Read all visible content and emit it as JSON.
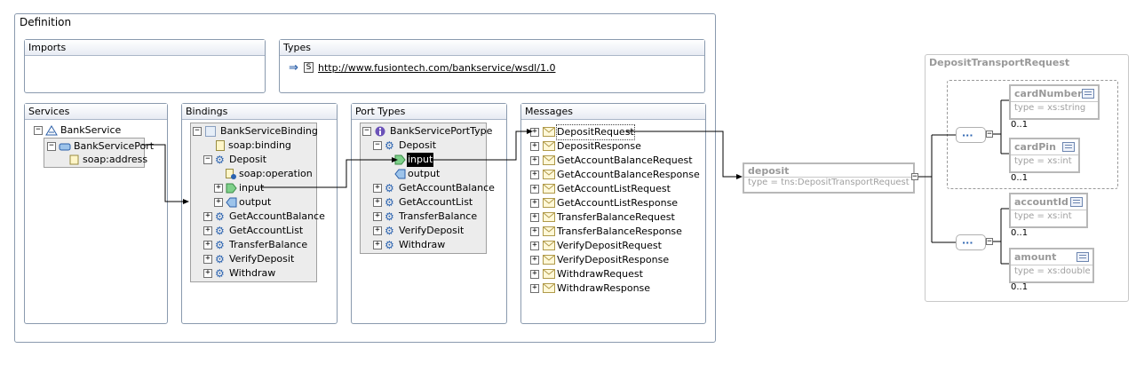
{
  "definition": {
    "title": "Definition"
  },
  "imports": {
    "title": "Imports"
  },
  "types": {
    "title": "Types",
    "link": "http://www.fusiontech.com/bankservice/wsdl/1.0"
  },
  "services": {
    "title": "Services",
    "service": "BankService",
    "port": "BankServicePort",
    "address": "soap:address"
  },
  "bindings": {
    "title": "Bindings",
    "root": "BankServiceBinding",
    "binding": "soap:binding",
    "deposit": "Deposit",
    "operation": "soap:operation",
    "input": "input",
    "output": "output",
    "others": [
      "GetAccountBalance",
      "GetAccountList",
      "TransferBalance",
      "VerifyDeposit",
      "Withdraw"
    ]
  },
  "porttypes": {
    "title": "Port Types",
    "root": "BankServicePortType",
    "deposit": "Deposit",
    "input": "input",
    "output": "output",
    "others": [
      "GetAccountBalance",
      "GetAccountList",
      "TransferBalance",
      "VerifyDeposit",
      "Withdraw"
    ]
  },
  "messages": {
    "title": "Messages",
    "items": [
      "DepositRequest",
      "DepositResponse",
      "GetAccountBalanceRequest",
      "GetAccountBalanceResponse",
      "GetAccountListRequest",
      "GetAccountListResponse",
      "TransferBalanceRequest",
      "TransferBalanceResponse",
      "VerifyDepositRequest",
      "VerifyDepositResponse",
      "WithdrawRequest",
      "WithdrawResponse"
    ]
  },
  "part": {
    "name": "deposit",
    "type": "type = tns:DepositTransportRequest"
  },
  "schema": {
    "title": "DepositTransportRequest",
    "elements": [
      {
        "name": "cardNumber",
        "type": "type = xs:string",
        "occ": "0..1"
      },
      {
        "name": "cardPin",
        "type": "type = xs:int",
        "occ": "0..1"
      },
      {
        "name": "accountId",
        "type": "type = xs:int",
        "occ": "0..1"
      },
      {
        "name": "amount",
        "type": "type = xs:double",
        "occ": "0..1"
      }
    ]
  },
  "colors": {
    "frame_border": "#8a9aae",
    "tree_bg": "#ececec",
    "graph_border": "#b8b8b8",
    "gear": "#2b63b0"
  }
}
